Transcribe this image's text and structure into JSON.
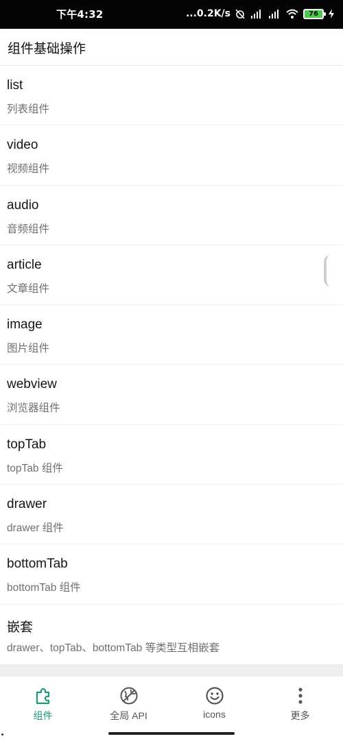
{
  "status_bar": {
    "time": "下午4:32",
    "network_speed": "...0.2K/s",
    "battery_level": "76",
    "icons": [
      "alarm-off-icon",
      "hd-signal-icon",
      "signal-icon",
      "wifi-icon",
      "battery-icon",
      "charging-icon"
    ]
  },
  "header": {
    "title": "组件基础操作"
  },
  "list": {
    "items": [
      {
        "title": "list",
        "subtitle": "列表组件"
      },
      {
        "title": "video",
        "subtitle": "视频组件"
      },
      {
        "title": "audio",
        "subtitle": "音频组件"
      },
      {
        "title": "article",
        "subtitle": "文章组件"
      },
      {
        "title": "image",
        "subtitle": "图片组件"
      },
      {
        "title": "webview",
        "subtitle": "浏览器组件"
      },
      {
        "title": "topTab",
        "subtitle": "topTab 组件"
      },
      {
        "title": "drawer",
        "subtitle": "drawer 组件"
      },
      {
        "title": "bottomTab",
        "subtitle": "bottomTab 组件"
      },
      {
        "title": "嵌套",
        "subtitle": "drawer、topTab、bottomTab 等类型互相嵌套"
      }
    ]
  },
  "tab_bar": {
    "active_color": "#1c9a7a",
    "tabs": [
      {
        "label": "组件",
        "icon": "puzzle-icon",
        "active": true
      },
      {
        "label": "全局 API",
        "icon": "globe-api-icon",
        "active": false
      },
      {
        "label": "icons",
        "icon": "smiley-icon",
        "active": false
      },
      {
        "label": "更多",
        "icon": "more-vertical-icon",
        "active": false
      }
    ]
  }
}
